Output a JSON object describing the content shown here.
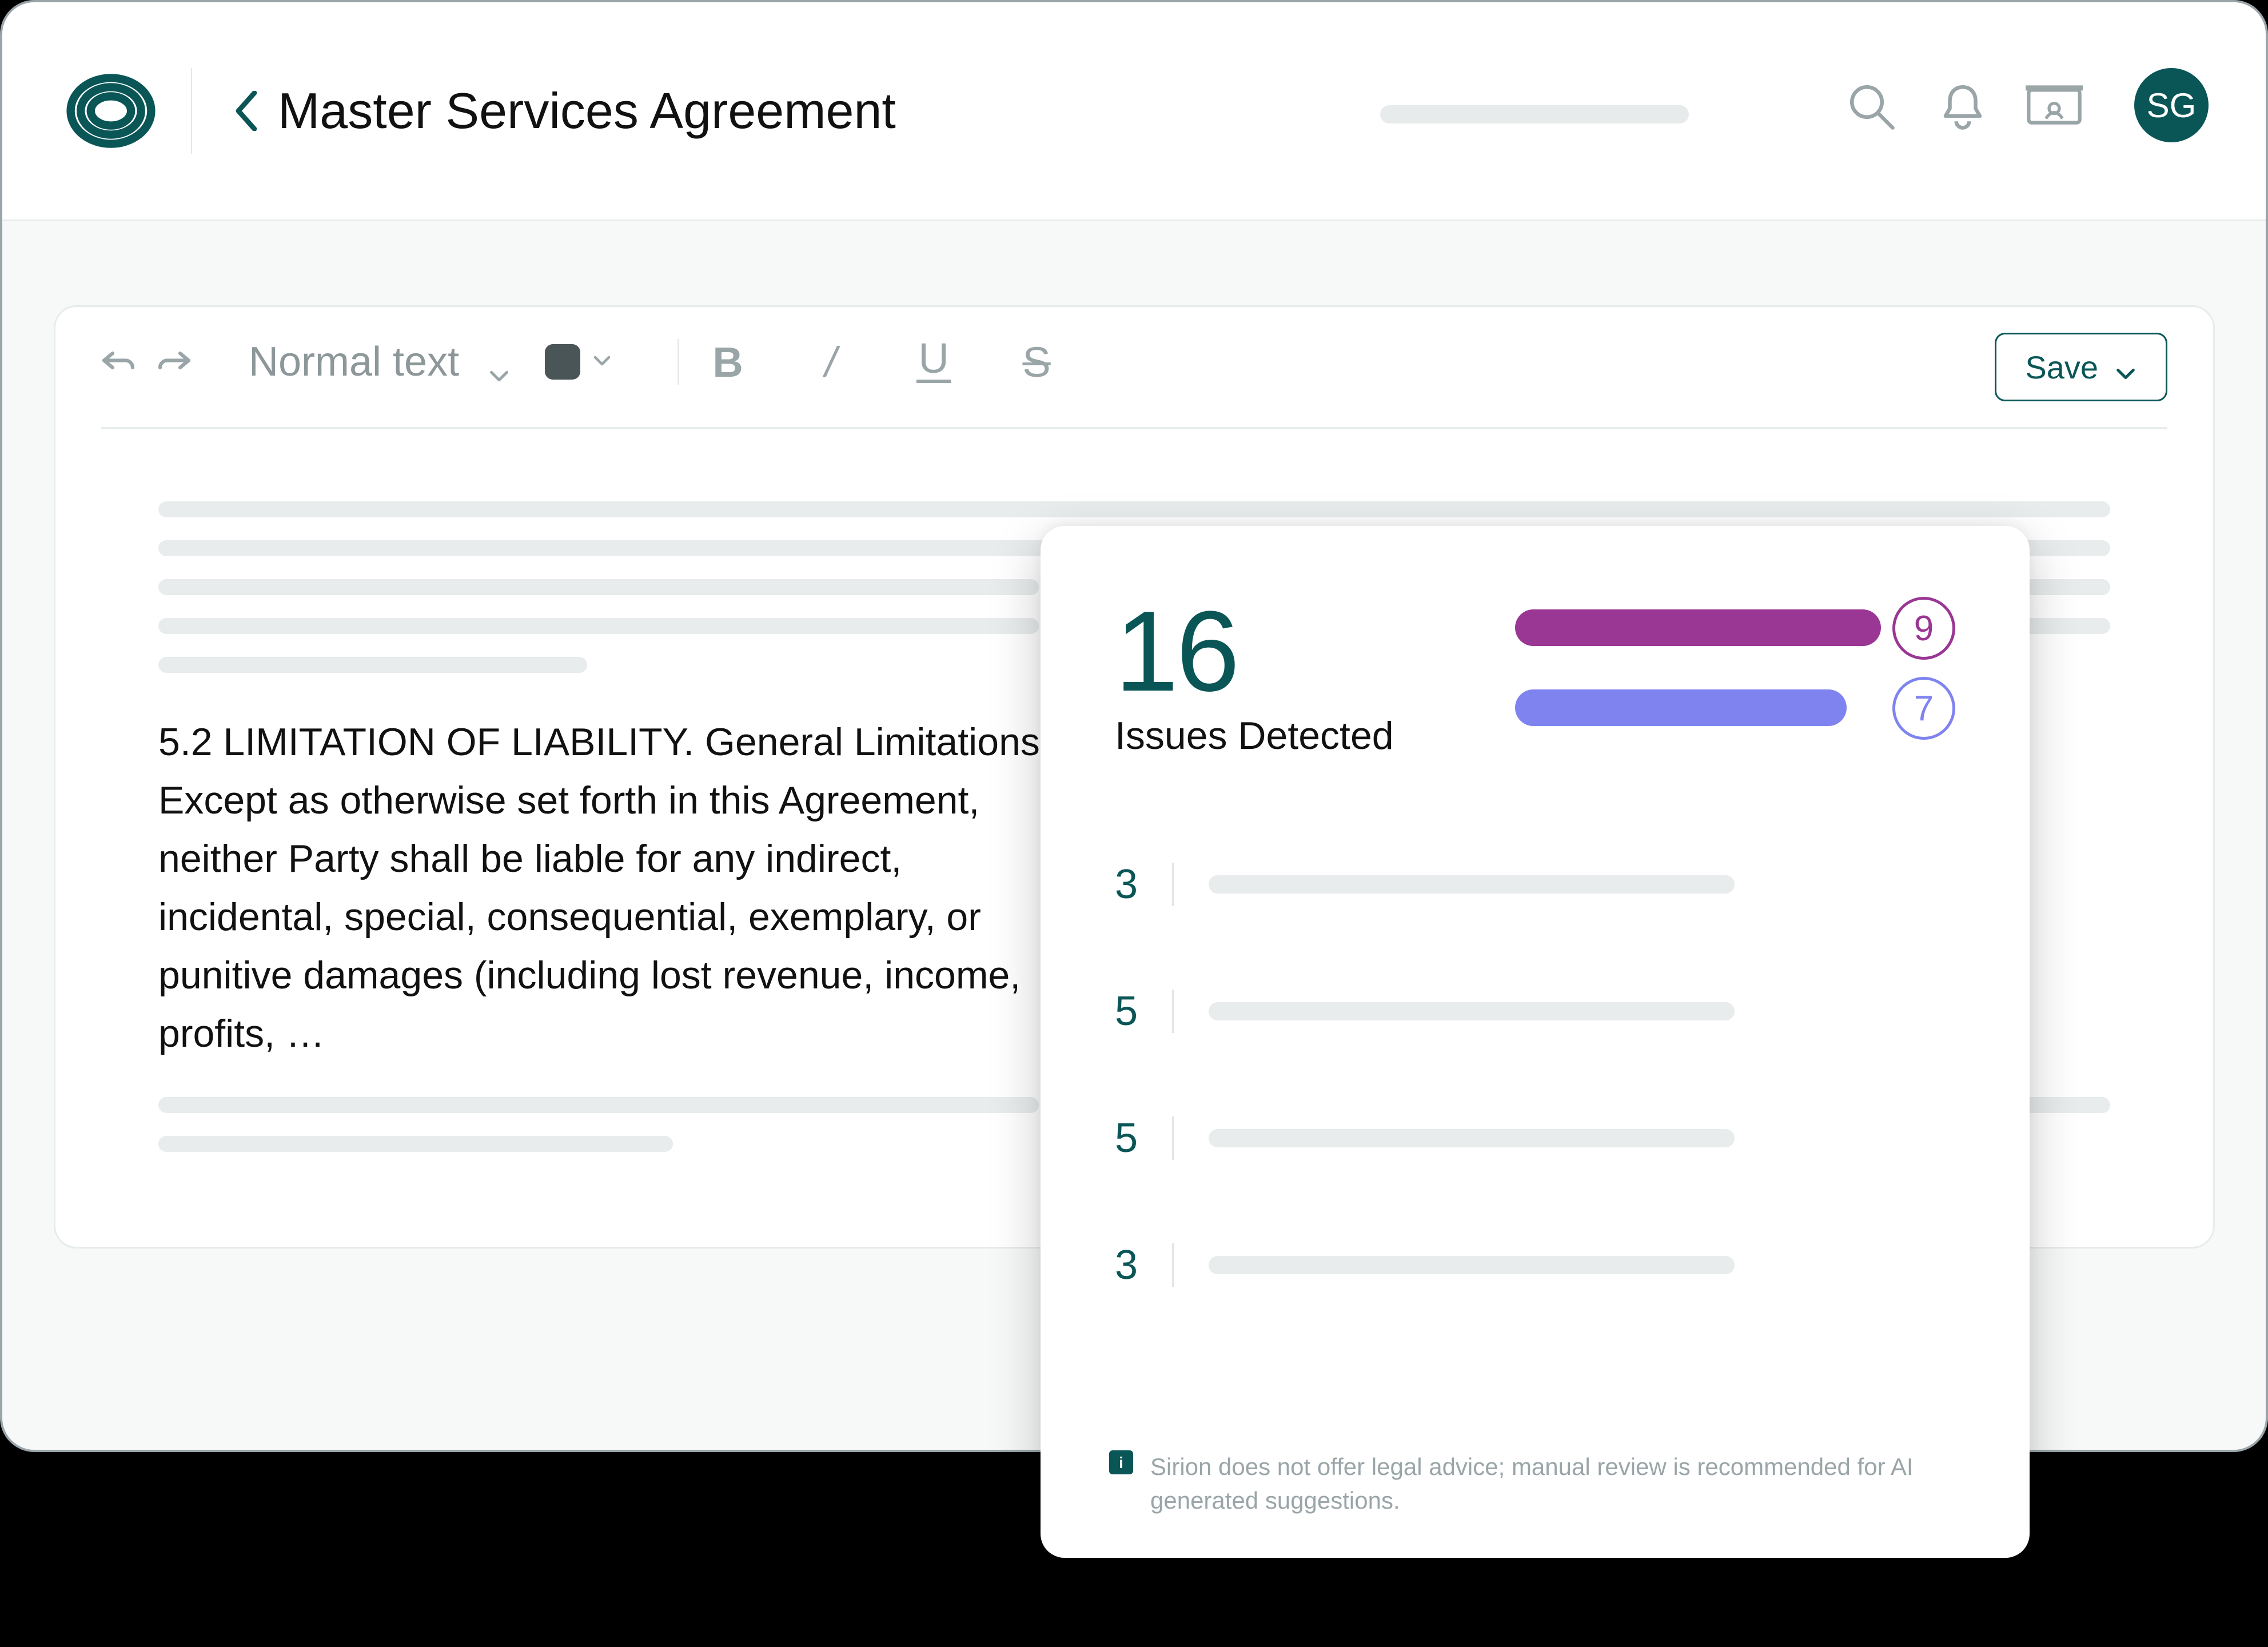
{
  "header": {
    "title": "Master Services Agreement",
    "avatar_initials": "SG",
    "icons": {
      "search": "search-icon",
      "bell": "bell-icon",
      "present": "present-icon"
    }
  },
  "toolbar": {
    "text_style_label": "Normal text",
    "save_label": "Save",
    "format": {
      "bold": "B",
      "italic": "/",
      "underline": "U",
      "strike": "S"
    }
  },
  "document": {
    "paragraph": "5.2 LIMITATION OF LIABILITY. General Limitations. Except as otherwise set forth in this Agreement, neither Party shall be liable for any indirect, incidental, special, consequential, exemplary, or punitive damages (including lost revenue, income, profits, …"
  },
  "issues": {
    "count": "16",
    "label": "Issues Detected",
    "bars": [
      {
        "value": "9",
        "color": "#9a3694"
      },
      {
        "value": "7",
        "color": "#7f83f0"
      }
    ],
    "rows": [
      {
        "count": "3"
      },
      {
        "count": "5"
      },
      {
        "count": "5"
      },
      {
        "count": "3"
      }
    ],
    "disclaimer": "Sirion does not offer legal advice; manual review is recommended for AI generated suggestions."
  }
}
